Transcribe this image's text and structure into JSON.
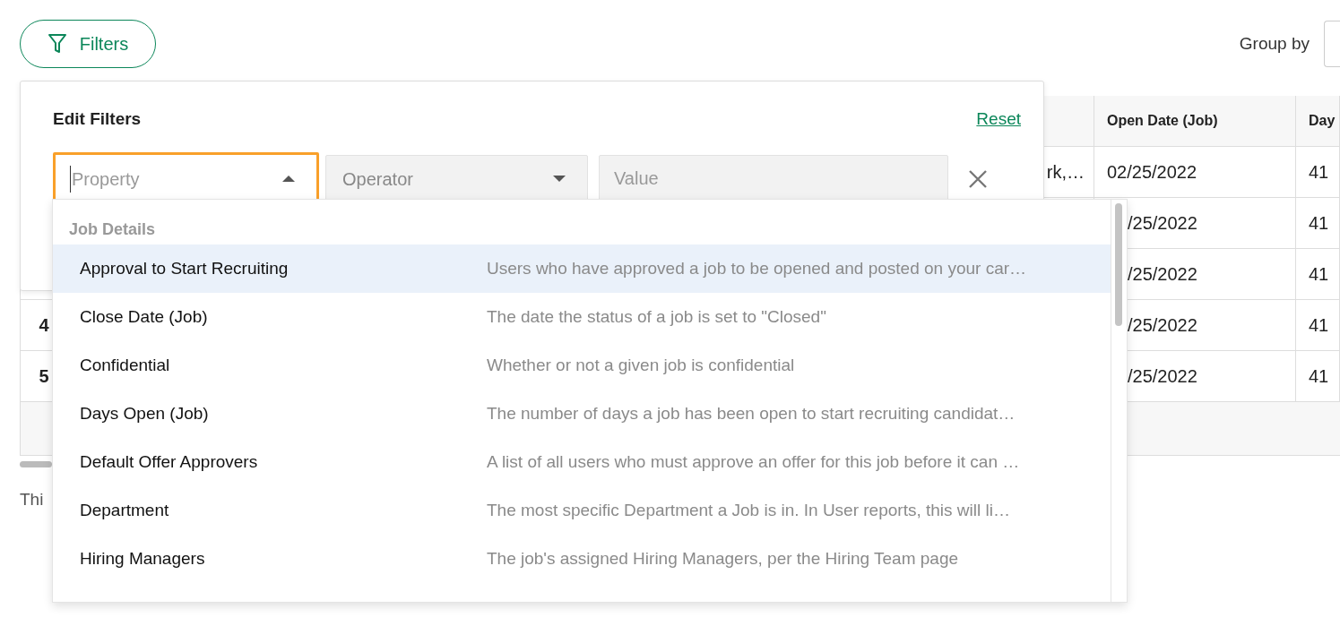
{
  "toolbar": {
    "filters_button": "Filters",
    "group_by_label": "Group by"
  },
  "table": {
    "columns": [
      {
        "label": "Open Date (Job)"
      },
      {
        "label": "Day"
      }
    ],
    "rows": [
      {
        "column_3": "rk,…",
        "column_4": "02/25/2022",
        "column_5": "41"
      },
      {
        "column_4": "/25/2022",
        "column_5": "41"
      },
      {
        "column_4": "/25/2022",
        "column_5": "41"
      },
      {
        "column_1": "4",
        "column_4": "/25/2022",
        "column_5": "41"
      },
      {
        "column_1": "5",
        "column_4": "/25/2022",
        "column_5": "41"
      }
    ],
    "footer_text": "Thi"
  },
  "filter_panel": {
    "title": "Edit Filters",
    "reset": "Reset",
    "property": {
      "placeholder": "Property",
      "expanded": true
    },
    "operator": {
      "placeholder": "Operator"
    },
    "value": {
      "placeholder": "Value"
    }
  },
  "dropdown": {
    "groups": [
      {
        "label": "Job Details",
        "items": [
          {
            "label": "Approval to Start Recruiting",
            "description": "Users who have approved a job to be opened and posted on your car…",
            "selected": true
          },
          {
            "label": "Close Date (Job)",
            "description": "The date the status of a job is set to \"Closed\"",
            "selected": false
          },
          {
            "label": "Confidential",
            "description": "Whether or not a given job is confidential",
            "selected": false
          },
          {
            "label": "Days Open (Job)",
            "description": "The number of days a job has been open to start recruiting candidat…",
            "selected": false
          },
          {
            "label": "Default Offer Approvers",
            "description": "A list of all users who must approve an offer for this job before it can …",
            "selected": false
          },
          {
            "label": "Department",
            "description": "The most specific Department a Job is in. In User reports, this will li…",
            "selected": false
          },
          {
            "label": "Hiring Managers",
            "description": "The job's assigned Hiring Managers, per the Hiring Team page",
            "selected": false
          }
        ]
      }
    ]
  }
}
